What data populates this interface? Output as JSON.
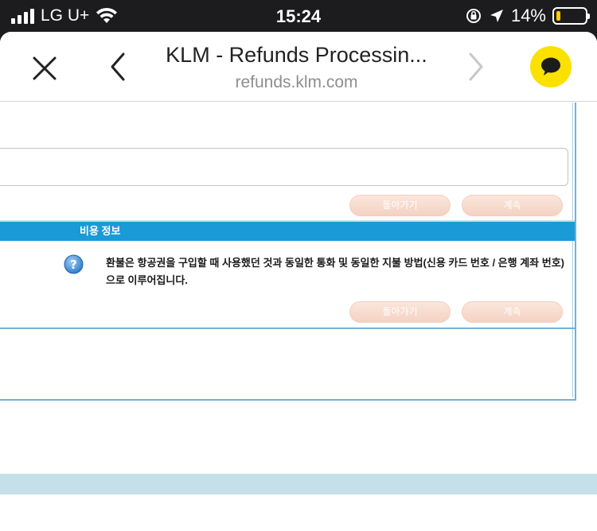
{
  "status_bar": {
    "carrier": "LG U+",
    "time": "15:24",
    "battery": "14%",
    "battery_level": 0.14
  },
  "browser": {
    "title": "KLM - Refunds Processin...",
    "url": "refunds.klm.com",
    "icons": [
      "close-icon",
      "back-icon",
      "forward-icon",
      "kakao-chat-icon"
    ]
  },
  "form": {
    "input_value": "",
    "buttons_top": {
      "back": "돌아가기",
      "continue": "계속"
    },
    "section_title": "비용 정보",
    "refund_message": "환불은 항공권을 구입할 때 사용했던 것과 동일한 통화 및 동일한 지불 방법(신용 카드 번호 / 은행 계좌 번호)으로 이루어집니다.",
    "buttons_bottom": {
      "back": "돌아가기",
      "continue": "계속"
    }
  },
  "colors": {
    "section_header": "#1a9ad6",
    "frame_border": "#6fb2d4",
    "button": "#f4d2c2",
    "kakao": "#fae100"
  }
}
